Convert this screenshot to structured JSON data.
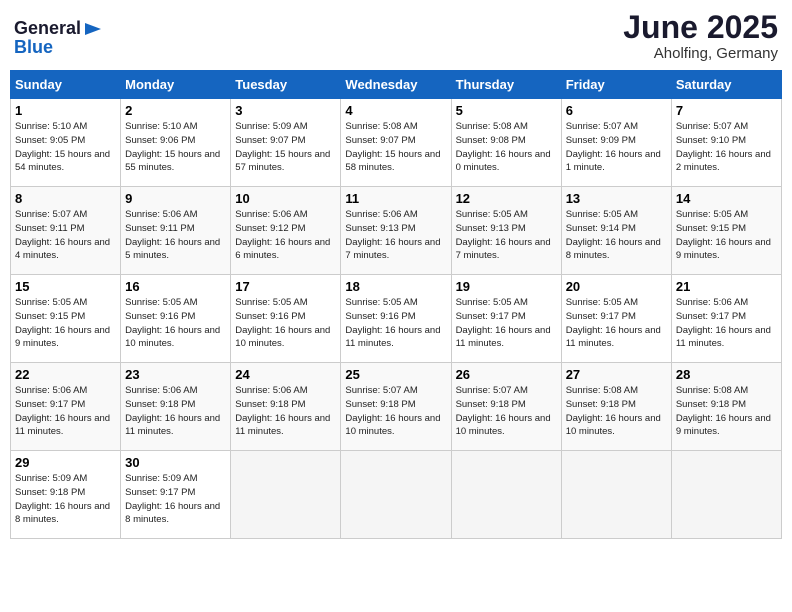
{
  "header": {
    "logo_general": "General",
    "logo_blue": "Blue",
    "month": "June 2025",
    "location": "Aholfing, Germany"
  },
  "days_of_week": [
    "Sunday",
    "Monday",
    "Tuesday",
    "Wednesday",
    "Thursday",
    "Friday",
    "Saturday"
  ],
  "weeks": [
    [
      {
        "day": "1",
        "sunrise": "5:10 AM",
        "sunset": "9:05 PM",
        "daylight": "15 hours and 54 minutes."
      },
      {
        "day": "2",
        "sunrise": "5:10 AM",
        "sunset": "9:06 PM",
        "daylight": "15 hours and 55 minutes."
      },
      {
        "day": "3",
        "sunrise": "5:09 AM",
        "sunset": "9:07 PM",
        "daylight": "15 hours and 57 minutes."
      },
      {
        "day": "4",
        "sunrise": "5:08 AM",
        "sunset": "9:07 PM",
        "daylight": "15 hours and 58 minutes."
      },
      {
        "day": "5",
        "sunrise": "5:08 AM",
        "sunset": "9:08 PM",
        "daylight": "16 hours and 0 minutes."
      },
      {
        "day": "6",
        "sunrise": "5:07 AM",
        "sunset": "9:09 PM",
        "daylight": "16 hours and 1 minute."
      },
      {
        "day": "7",
        "sunrise": "5:07 AM",
        "sunset": "9:10 PM",
        "daylight": "16 hours and 2 minutes."
      }
    ],
    [
      {
        "day": "8",
        "sunrise": "5:07 AM",
        "sunset": "9:11 PM",
        "daylight": "16 hours and 4 minutes."
      },
      {
        "day": "9",
        "sunrise": "5:06 AM",
        "sunset": "9:11 PM",
        "daylight": "16 hours and 5 minutes."
      },
      {
        "day": "10",
        "sunrise": "5:06 AM",
        "sunset": "9:12 PM",
        "daylight": "16 hours and 6 minutes."
      },
      {
        "day": "11",
        "sunrise": "5:06 AM",
        "sunset": "9:13 PM",
        "daylight": "16 hours and 7 minutes."
      },
      {
        "day": "12",
        "sunrise": "5:05 AM",
        "sunset": "9:13 PM",
        "daylight": "16 hours and 7 minutes."
      },
      {
        "day": "13",
        "sunrise": "5:05 AM",
        "sunset": "9:14 PM",
        "daylight": "16 hours and 8 minutes."
      },
      {
        "day": "14",
        "sunrise": "5:05 AM",
        "sunset": "9:15 PM",
        "daylight": "16 hours and 9 minutes."
      }
    ],
    [
      {
        "day": "15",
        "sunrise": "5:05 AM",
        "sunset": "9:15 PM",
        "daylight": "16 hours and 9 minutes."
      },
      {
        "day": "16",
        "sunrise": "5:05 AM",
        "sunset": "9:16 PM",
        "daylight": "16 hours and 10 minutes."
      },
      {
        "day": "17",
        "sunrise": "5:05 AM",
        "sunset": "9:16 PM",
        "daylight": "16 hours and 10 minutes."
      },
      {
        "day": "18",
        "sunrise": "5:05 AM",
        "sunset": "9:16 PM",
        "daylight": "16 hours and 11 minutes."
      },
      {
        "day": "19",
        "sunrise": "5:05 AM",
        "sunset": "9:17 PM",
        "daylight": "16 hours and 11 minutes."
      },
      {
        "day": "20",
        "sunrise": "5:05 AM",
        "sunset": "9:17 PM",
        "daylight": "16 hours and 11 minutes."
      },
      {
        "day": "21",
        "sunrise": "5:06 AM",
        "sunset": "9:17 PM",
        "daylight": "16 hours and 11 minutes."
      }
    ],
    [
      {
        "day": "22",
        "sunrise": "5:06 AM",
        "sunset": "9:17 PM",
        "daylight": "16 hours and 11 minutes."
      },
      {
        "day": "23",
        "sunrise": "5:06 AM",
        "sunset": "9:18 PM",
        "daylight": "16 hours and 11 minutes."
      },
      {
        "day": "24",
        "sunrise": "5:06 AM",
        "sunset": "9:18 PM",
        "daylight": "16 hours and 11 minutes."
      },
      {
        "day": "25",
        "sunrise": "5:07 AM",
        "sunset": "9:18 PM",
        "daylight": "16 hours and 10 minutes."
      },
      {
        "day": "26",
        "sunrise": "5:07 AM",
        "sunset": "9:18 PM",
        "daylight": "16 hours and 10 minutes."
      },
      {
        "day": "27",
        "sunrise": "5:08 AM",
        "sunset": "9:18 PM",
        "daylight": "16 hours and 10 minutes."
      },
      {
        "day": "28",
        "sunrise": "5:08 AM",
        "sunset": "9:18 PM",
        "daylight": "16 hours and 9 minutes."
      }
    ],
    [
      {
        "day": "29",
        "sunrise": "5:09 AM",
        "sunset": "9:18 PM",
        "daylight": "16 hours and 8 minutes."
      },
      {
        "day": "30",
        "sunrise": "5:09 AM",
        "sunset": "9:17 PM",
        "daylight": "16 hours and 8 minutes."
      },
      null,
      null,
      null,
      null,
      null
    ]
  ],
  "labels": {
    "sunrise": "Sunrise:",
    "sunset": "Sunset:",
    "daylight": "Daylight:"
  }
}
